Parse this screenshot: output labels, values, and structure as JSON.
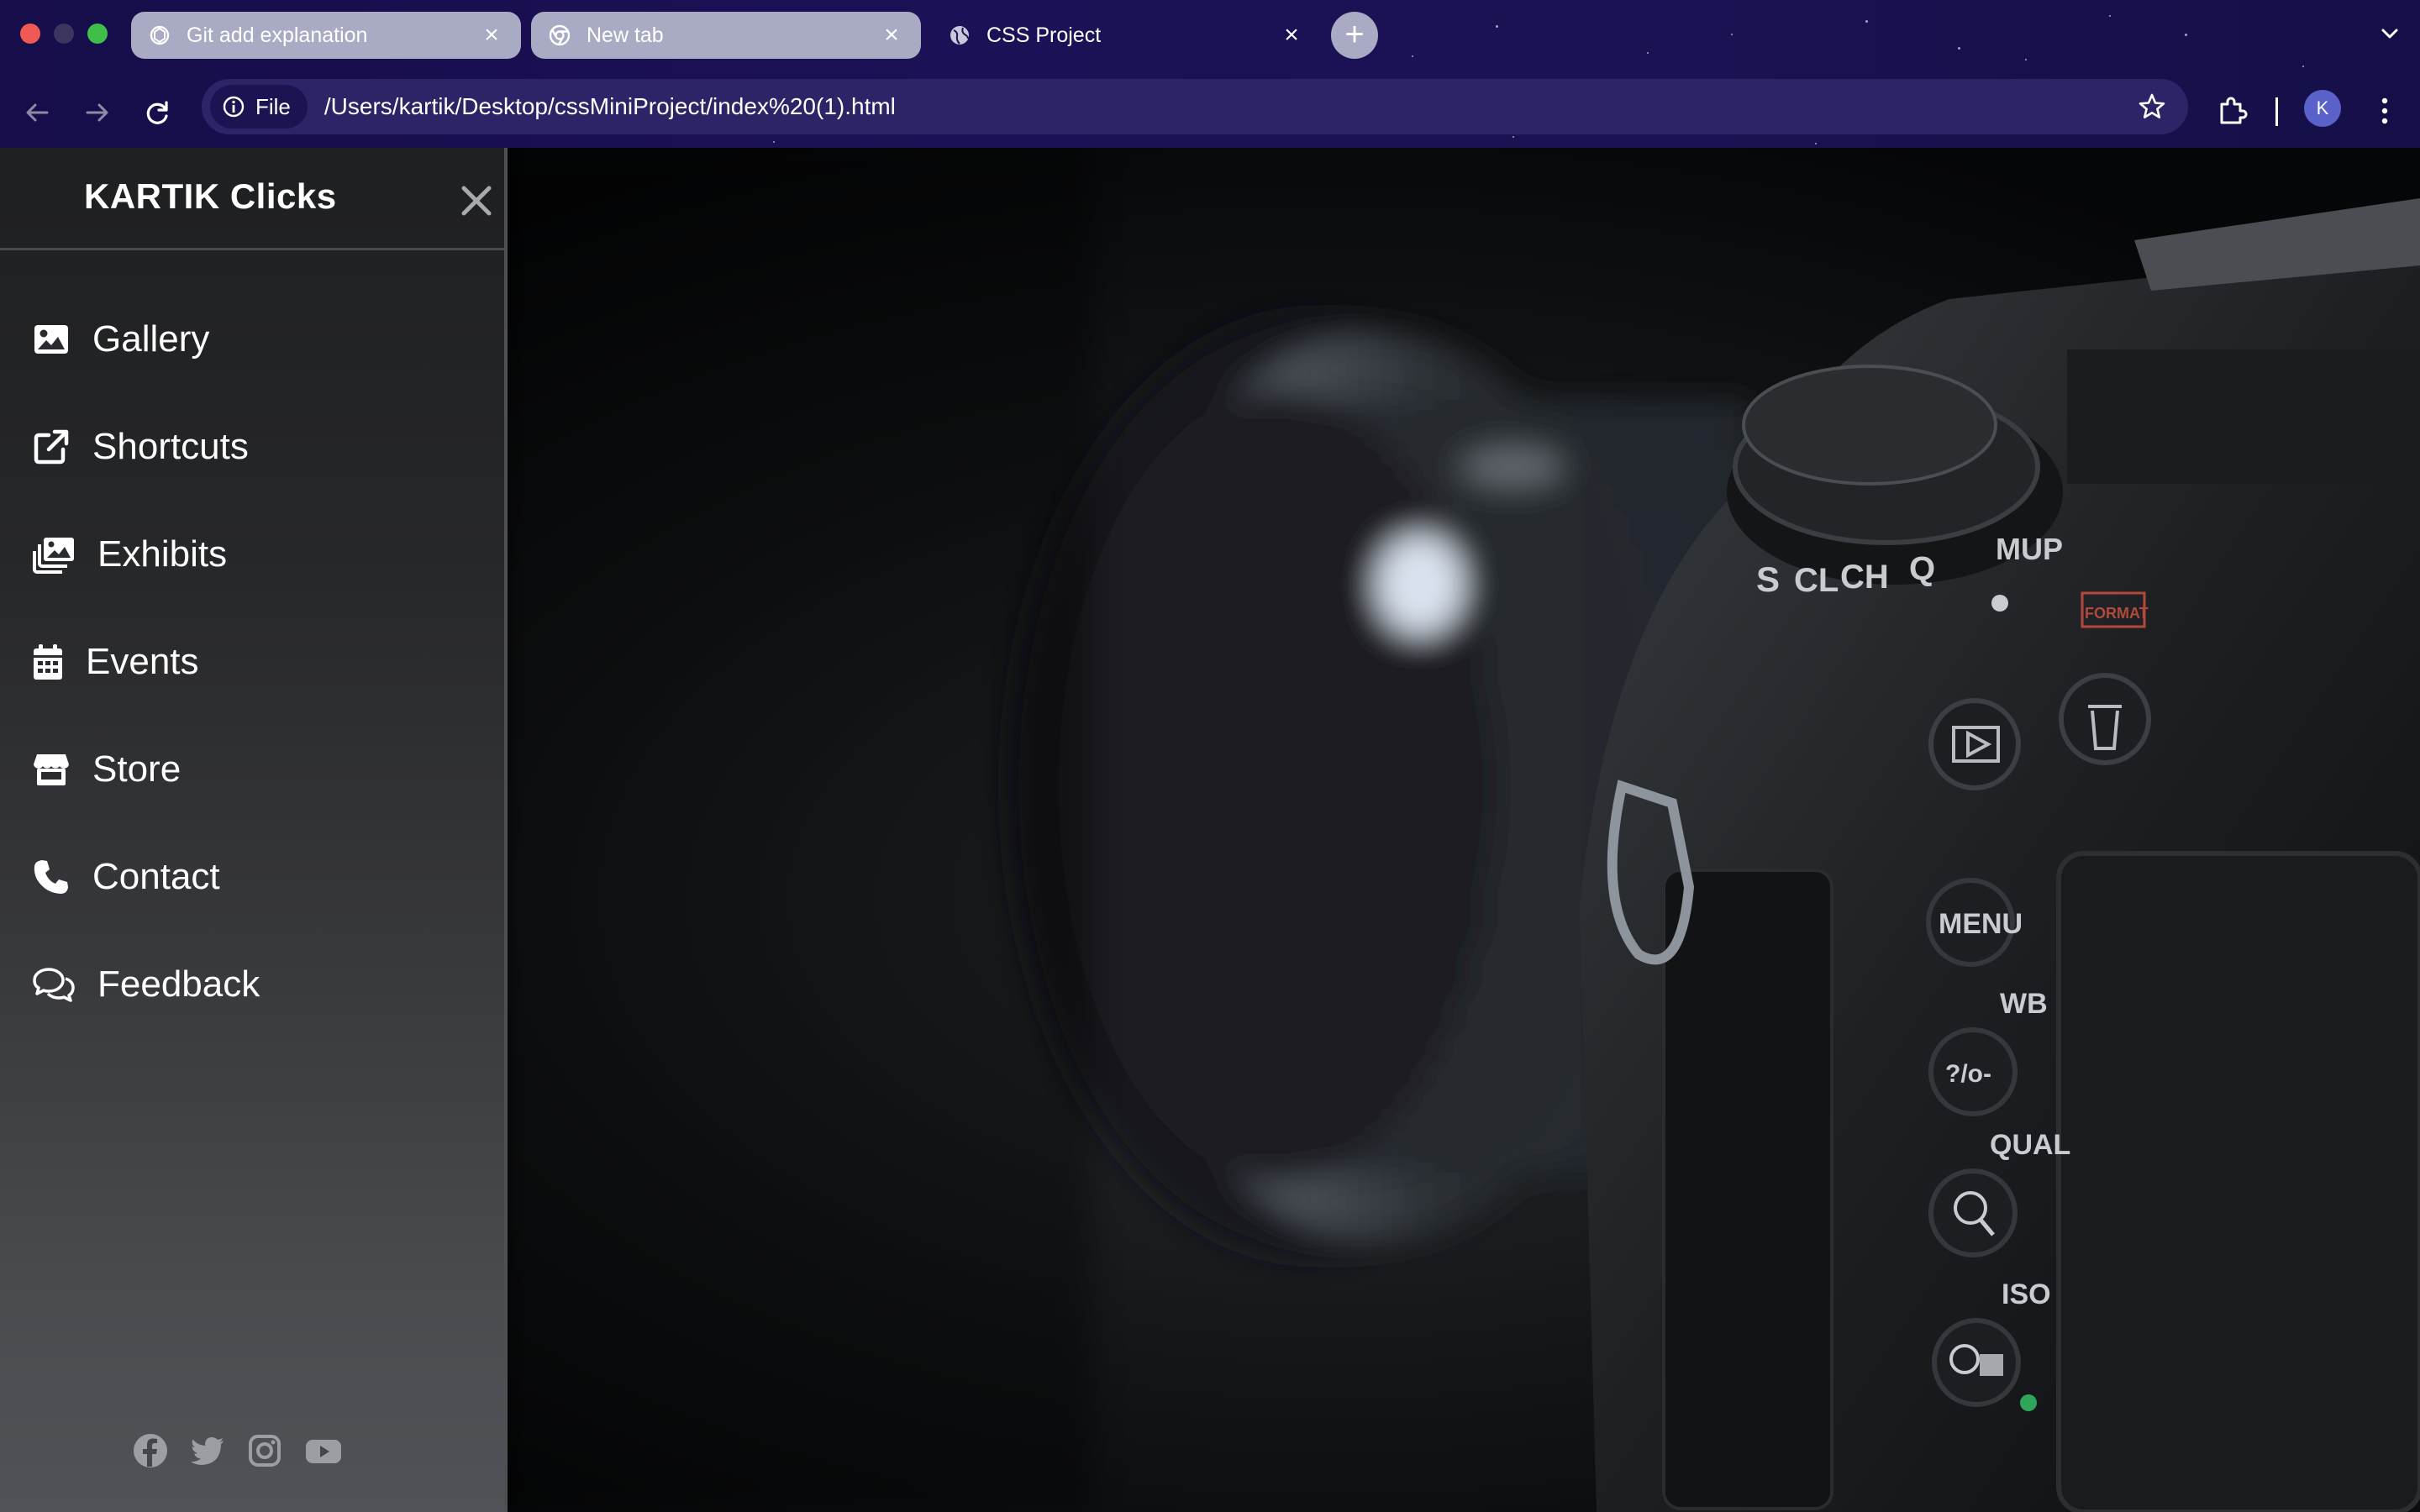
{
  "browser": {
    "tabs": [
      {
        "title": "Git add explanation",
        "state": "inactive",
        "favicon": "openai-icon"
      },
      {
        "title": "New tab",
        "state": "inactive",
        "favicon": "chrome-icon"
      },
      {
        "title": "CSS Project",
        "state": "active",
        "favicon": "globe-icon"
      }
    ],
    "address": {
      "chip_label": "File",
      "url": "/Users/kartik/Desktop/cssMiniProject/index%20(1).html"
    },
    "profile_initial": "K"
  },
  "sidebar": {
    "brand": "KARTIK Clicks",
    "items": [
      {
        "label": "Gallery",
        "icon": "image-icon"
      },
      {
        "label": "Shortcuts",
        "icon": "external-link-icon"
      },
      {
        "label": "Exhibits",
        "icon": "photos-icon"
      },
      {
        "label": "Events",
        "icon": "calendar-icon"
      },
      {
        "label": "Store",
        "icon": "store-icon"
      },
      {
        "label": "Contact",
        "icon": "phone-icon"
      },
      {
        "label": "Feedback",
        "icon": "comments-icon"
      }
    ],
    "socials": [
      "facebook-icon",
      "twitter-icon",
      "instagram-icon",
      "youtube-icon"
    ]
  },
  "hero": {
    "dial_marks": [
      "S",
      "CL",
      "CH",
      "Q",
      "MUP"
    ],
    "format_label": "FORMAT",
    "button_labels": [
      "MENU",
      "WB",
      "QUAL",
      "ISO"
    ]
  },
  "colors": {
    "chrome_bg": "#1b1156",
    "omnibox_bg": "#2c2466",
    "tab_inactive": "#a9aac3",
    "sidebar_top": "#1e1f21",
    "sidebar_bottom": "#505257"
  }
}
